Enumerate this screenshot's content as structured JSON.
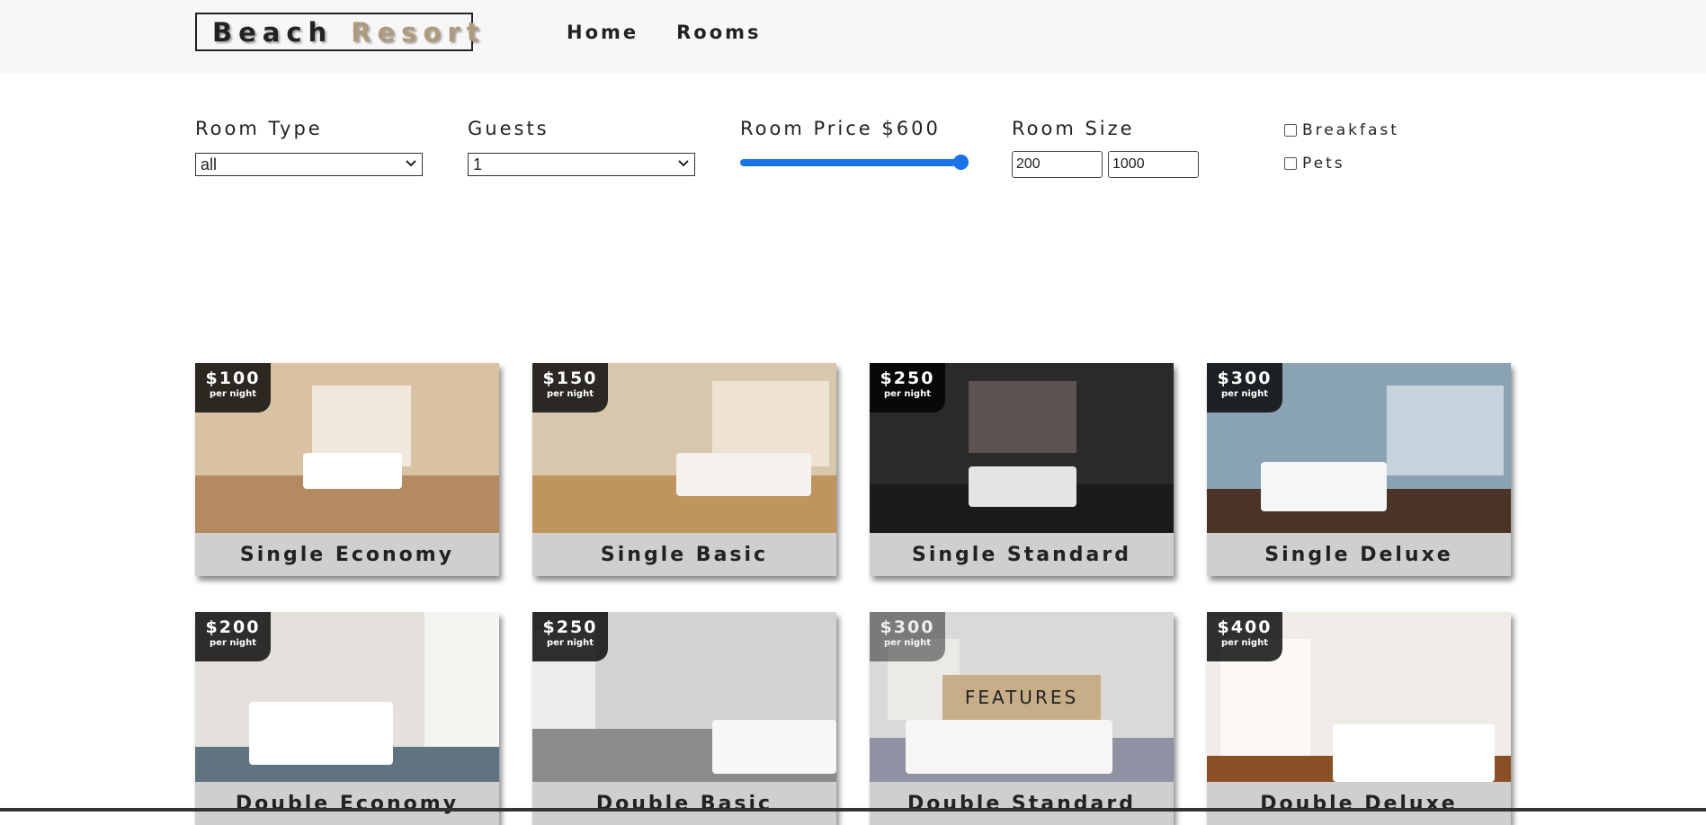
{
  "navbar": {
    "logo_word1": "Beach",
    "logo_word2": "Resort",
    "links": [
      "Home",
      "Rooms"
    ]
  },
  "filters": {
    "room_type": {
      "label": "Room Type",
      "value": "all"
    },
    "guests": {
      "label": "Guests",
      "value": "1"
    },
    "price": {
      "label": "Room Price $600",
      "value": 600,
      "max": 600
    },
    "size": {
      "label": "Room Size",
      "min": "200",
      "max": "1000"
    },
    "breakfast": {
      "label": "Breakfast",
      "checked": false
    },
    "pets": {
      "label": "Pets",
      "checked": false
    }
  },
  "rooms": [
    {
      "name": "Single Economy",
      "price": "$100",
      "per": "per night",
      "palette": [
        "#d9c2a4",
        "#f1e8dc",
        "#b48a60",
        "#ffffff"
      ]
    },
    {
      "name": "Single Basic",
      "price": "$150",
      "per": "per night",
      "palette": [
        "#d8c6ad",
        "#eee3d3",
        "#c0945e",
        "#f5f2ee"
      ]
    },
    {
      "name": "Single Standard",
      "price": "$250",
      "per": "per night",
      "palette": [
        "#2a2a2a",
        "#5a5350",
        "#1a1a1a",
        "#e6e4e2"
      ]
    },
    {
      "name": "Single Deluxe",
      "price": "$300",
      "per": "per night",
      "palette": [
        "#8aa3b3",
        "#c6d3dc",
        "#4a3426",
        "#f4f6f8"
      ]
    },
    {
      "name": "Double Economy",
      "price": "$200",
      "per": "per night",
      "palette": [
        "#e4e1dc",
        "#f6f4f0",
        "#5f7480",
        "#ffffff"
      ]
    },
    {
      "name": "Double Basic",
      "price": "$250",
      "per": "per night",
      "palette": [
        "#d2d2d2",
        "#ececec",
        "#8c8c8c",
        "#f7f7f7"
      ]
    },
    {
      "name": "Double Standard",
      "price": "$300",
      "per": "per night",
      "palette": [
        "#bdbab6",
        "#dcd9d4",
        "#323a56",
        "#f0efed"
      ],
      "hover": true,
      "features_label": "FEATURES"
    },
    {
      "name": "Double Deluxe",
      "price": "$400",
      "per": "per night",
      "palette": [
        "#f0ece8",
        "#fbf8f5",
        "#8a4f24",
        "#ffffff"
      ]
    }
  ]
}
